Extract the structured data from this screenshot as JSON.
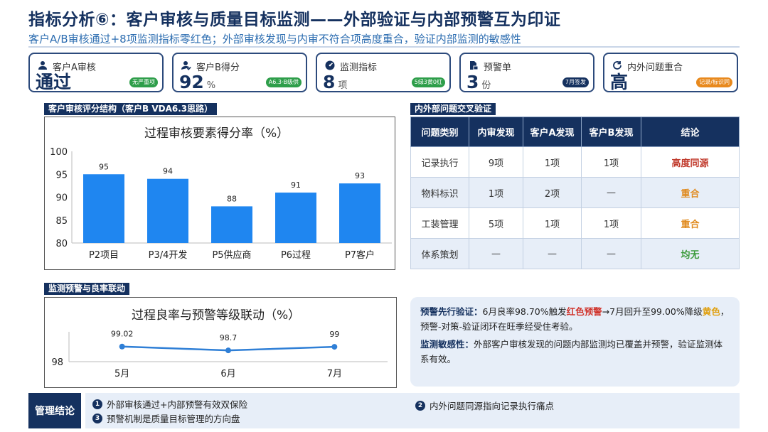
{
  "header": {
    "title": "指标分析⑥：客户审核与质量目标监测——外部验证与内部预警互为印证",
    "subtitle": "客户A/B审核通过+8项监测指标零红色；外部审核发现与内审不符合项高度重合，验证内部监测的敏感性"
  },
  "kpis": [
    {
      "icon": "user-icon",
      "label": "客户A审核",
      "value": "通过",
      "unit": "",
      "tag": "无严重项",
      "tag_color": "#2e9e4a"
    },
    {
      "icon": "user-check-icon",
      "label": "客户B得分",
      "value": "92",
      "unit": "%",
      "tag": "A6.3·B级供",
      "tag_color": "#2e9e4a"
    },
    {
      "icon": "gauge-icon",
      "label": "监测指标",
      "value": "8",
      "unit": "项",
      "tag": "5绿3黄0红",
      "tag_color": "#2e9e4a"
    },
    {
      "icon": "document-lock-icon",
      "label": "预警单",
      "value": "3",
      "unit": "份",
      "tag": "7月签发",
      "tag_color": "#15315f"
    },
    {
      "icon": "refresh-icon",
      "label": "内外问题重合",
      "value": "高",
      "unit": "",
      "tag": "记录/标识同",
      "tag_color": "#e8891d"
    }
  ],
  "sections": {
    "audit_structure": "客户审核评分结构（客户B VDA6.3思路）",
    "cross_check": "内外部问题交叉验证",
    "monitor_link": "监测预警与良率联动"
  },
  "chart_data": [
    {
      "type": "bar",
      "title": "过程审核要素得分率（%）",
      "categories": [
        "P2项目",
        "P3/4开发",
        "P5供应商",
        "P6过程",
        "P7客户"
      ],
      "values": [
        95,
        94,
        88,
        91,
        93
      ],
      "ylim": [
        80,
        100
      ],
      "yticks": [
        80,
        85,
        90,
        95,
        100
      ],
      "color": "#1f86f0",
      "grid": false
    },
    {
      "type": "line",
      "title": "过程良率与预警等级联动（%）",
      "categories": [
        "5月",
        "6月",
        "7月"
      ],
      "values": [
        99.02,
        98.7,
        99
      ],
      "value_labels": [
        "99.02",
        "98.7",
        "99"
      ],
      "ylim": [
        98,
        99.3
      ],
      "yticks": [
        98
      ],
      "color": "#2f7fd6",
      "grid": false
    }
  ],
  "cross_table": {
    "headers": [
      "问题类别",
      "内审发现",
      "客户A发现",
      "客户B发现",
      "结论"
    ],
    "rows": [
      [
        "记录执行",
        "9项",
        "1项",
        "1项",
        "高度同源"
      ],
      [
        "物料标识",
        "1项",
        "2项",
        "—",
        "重合"
      ],
      [
        "工装管理",
        "5项",
        "1项",
        "1项",
        "重合"
      ],
      [
        "体系策划",
        "—",
        "—",
        "—",
        "均无"
      ]
    ],
    "conclusion_colors": [
      "#c0392b",
      "#e08a1e",
      "#e08a1e",
      "#3a9a3a"
    ]
  },
  "note": {
    "p1_label": "预警先行验证：",
    "p1_a": "6月良率98.70%触发",
    "p1_red": "红色预警",
    "p1_b": "→7月回升至99.00%降级",
    "p1_yellow": "黄色",
    "p1_c": "，预警-对策-验证闭环在旺季经受住考验。",
    "p2_label": "监测敏感性：",
    "p2_text": "外部客户审核发现的问题内部监测均已覆盖并预警，验证监测体系有效。"
  },
  "conclusion": {
    "label": "管理结论",
    "items": [
      {
        "num": "1",
        "text": "外部审核通过+内部预警有效双保险"
      },
      {
        "num": "2",
        "text": "内外问题同源指向记录执行痛点"
      },
      {
        "num": "3",
        "text": "预警机制是质量目标管理的方向盘"
      }
    ]
  }
}
